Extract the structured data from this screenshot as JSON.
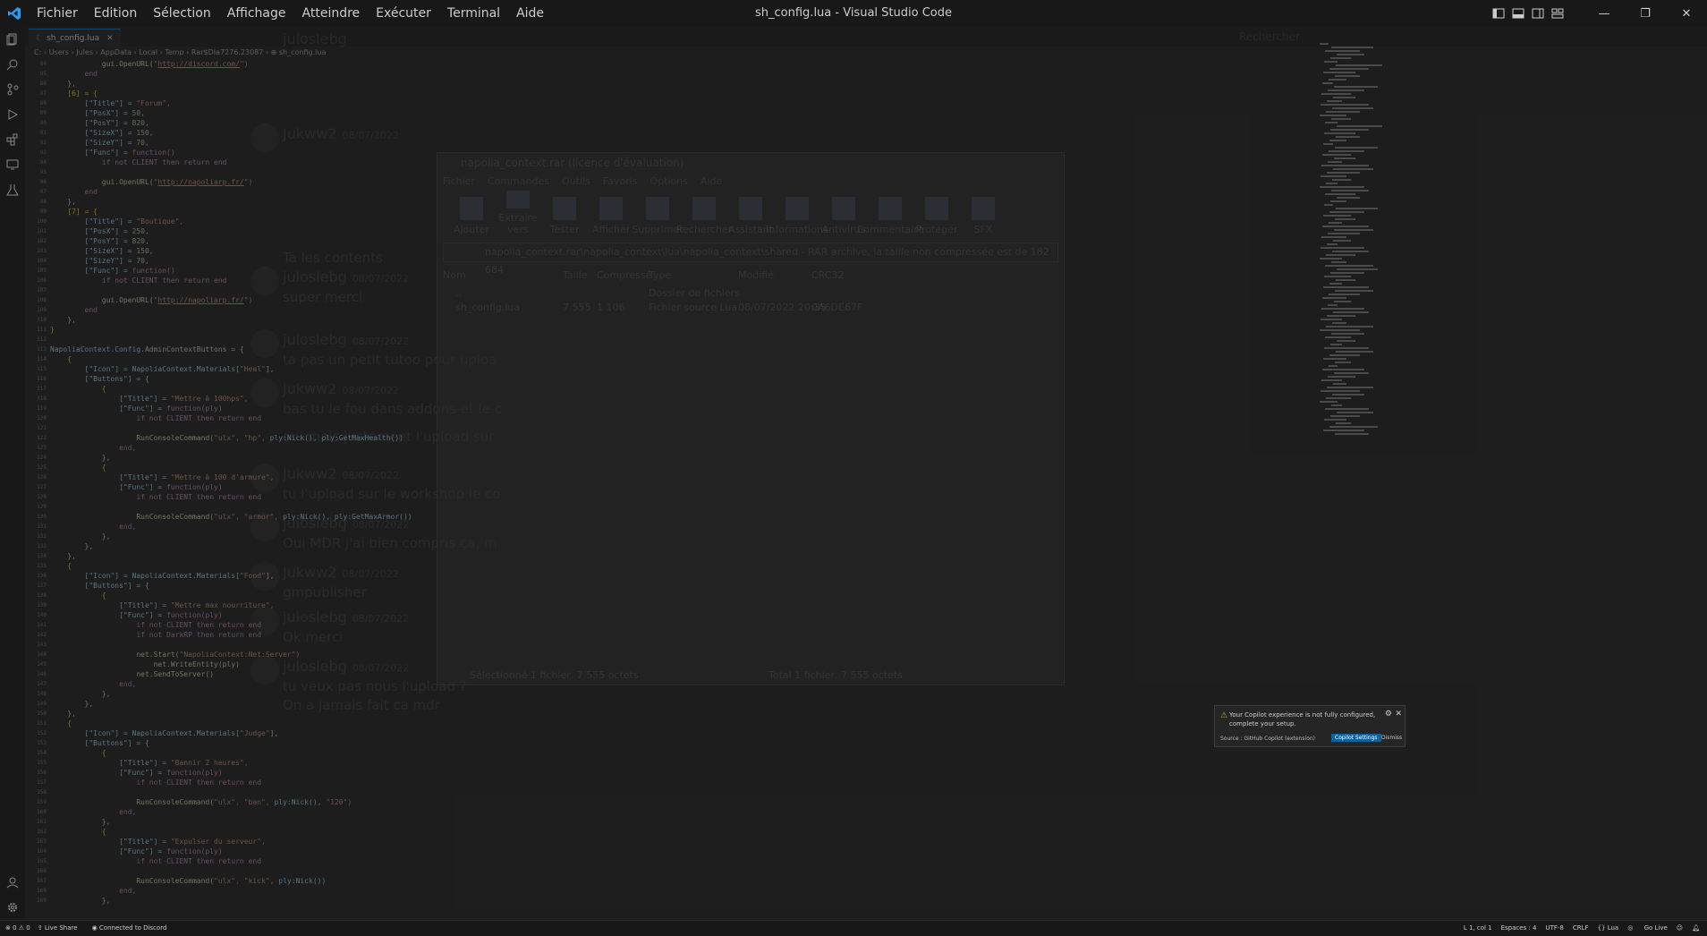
{
  "window": {
    "title": "sh_config.lua - Visual Studio Code"
  },
  "menu": [
    "Fichier",
    "Edition",
    "Sélection",
    "Affichage",
    "Atteindre",
    "Exécuter",
    "Terminal",
    "Aide"
  ],
  "tab": {
    "label": "sh_config.lua",
    "lang_badge": "☾"
  },
  "breadcrumb": "C: › Users › Jules › AppData › Local › Temp › Rar$DIa7276.23087 › ⊕ sh_config.lua",
  "activity_icons": [
    "explorer-icon",
    "search-icon",
    "source-control-icon",
    "run-debug-icon",
    "extensions-icon",
    "remote-explorer-icon",
    "testing-icon"
  ],
  "line_start": 84,
  "code_lines": [
    [
      [
        "            ",
        ""
      ],
      [
        "gui.OpenURL(",
        "f"
      ],
      [
        "\"",
        "s"
      ],
      [
        "http://discord.com/",
        "su"
      ],
      [
        "\")",
        "s"
      ]
    ],
    [
      [
        "        end",
        "k"
      ]
    ],
    [
      [
        "    },",
        ""
      ]
    ],
    [
      [
        "    [6] = {",
        "b"
      ]
    ],
    [
      [
        "        [\"Title\"] = ",
        "v"
      ],
      [
        "\"Forum\",",
        "s"
      ]
    ],
    [
      [
        "        [\"PosX\"] = ",
        "v"
      ],
      [
        "50,",
        "n"
      ]
    ],
    [
      [
        "        [\"PosY\"] = ",
        "v"
      ],
      [
        "820,",
        "n"
      ]
    ],
    [
      [
        "        [\"SizeX\"] = ",
        "v"
      ],
      [
        "150,",
        "n"
      ]
    ],
    [
      [
        "        [\"SizeY\"] = ",
        "v"
      ],
      [
        "70,",
        "n"
      ]
    ],
    [
      [
        "        [\"Func\"] = ",
        "v"
      ],
      [
        "function()",
        "k"
      ]
    ],
    [
      [
        "            if not CLIENT then return end",
        "k"
      ]
    ],
    [
      [
        "",
        ""
      ]
    ],
    [
      [
        "            ",
        ""
      ],
      [
        "gui.OpenURL(",
        "f"
      ],
      [
        "\"",
        "s"
      ],
      [
        "http://napoliarp.fr/",
        "su"
      ],
      [
        "\")",
        "s"
      ]
    ],
    [
      [
        "        end",
        "k"
      ]
    ],
    [
      [
        "    },",
        ""
      ]
    ],
    [
      [
        "    [7] = {",
        "b"
      ]
    ],
    [
      [
        "        [\"Title\"] = ",
        "v"
      ],
      [
        "\"Boutique\",",
        "s"
      ]
    ],
    [
      [
        "        [\"PosX\"] = ",
        "v"
      ],
      [
        "250,",
        "n"
      ]
    ],
    [
      [
        "        [\"PosY\"] = ",
        "v"
      ],
      [
        "820,",
        "n"
      ]
    ],
    [
      [
        "        [\"SizeX\"] = ",
        "v"
      ],
      [
        "150,",
        "n"
      ]
    ],
    [
      [
        "        [\"SizeY\"] = ",
        "v"
      ],
      [
        "70,",
        "n"
      ]
    ],
    [
      [
        "        [\"Func\"] = ",
        "v"
      ],
      [
        "function()",
        "k"
      ]
    ],
    [
      [
        "            if not CLIENT then return end",
        "k"
      ]
    ],
    [
      [
        "",
        ""
      ]
    ],
    [
      [
        "            ",
        ""
      ],
      [
        "gui.OpenURL(",
        "f"
      ],
      [
        "\"",
        "s"
      ],
      [
        "http://napoliarp.fr/",
        "su"
      ],
      [
        "\")",
        "s"
      ]
    ],
    [
      [
        "        end",
        "k"
      ]
    ],
    [
      [
        "    },",
        ""
      ]
    ],
    [
      [
        "}",
        "b"
      ]
    ],
    [
      [
        "",
        ""
      ]
    ],
    [
      [
        "NapoliaContext.",
        "v"
      ],
      [
        "Config",
        "v"
      ],
      [
        ".AdminContextButtons = {",
        ""
      ]
    ],
    [
      [
        "    {",
        "b"
      ]
    ],
    [
      [
        "        [\"Icon\"] = NapoliaContext.Materials[",
        "v"
      ],
      [
        "\"Heal\"",
        "s"
      ],
      [
        "],",
        ""
      ]
    ],
    [
      [
        "        [\"Buttons\"] = {",
        "v"
      ]
    ],
    [
      [
        "            {",
        "b"
      ]
    ],
    [
      [
        "                [\"Title\"] = ",
        "v"
      ],
      [
        "\"Mettre à 100hps\",",
        "s"
      ]
    ],
    [
      [
        "                [\"Func\"] = ",
        "v"
      ],
      [
        "function(ply)",
        "k"
      ]
    ],
    [
      [
        "                    if not CLIENT then return end",
        "k"
      ]
    ],
    [
      [
        "",
        ""
      ]
    ],
    [
      [
        "                    ",
        ""
      ],
      [
        "RunConsoleCommand(",
        "f"
      ],
      [
        "\"ulx\", \"hp\", ",
        "s"
      ],
      [
        "ply:Nick(), ply:GetMaxHealth())",
        "v"
      ]
    ],
    [
      [
        "                end,",
        "k"
      ]
    ],
    [
      [
        "            },",
        ""
      ]
    ],
    [
      [
        "            {",
        "b"
      ]
    ],
    [
      [
        "                [\"Title\"] = ",
        "v"
      ],
      [
        "\"Mettre à 100 d'armure\",",
        "s"
      ]
    ],
    [
      [
        "                [\"Func\"] = ",
        "v"
      ],
      [
        "function(ply)",
        "k"
      ]
    ],
    [
      [
        "                    if not CLIENT then return end",
        "k"
      ]
    ],
    [
      [
        "",
        ""
      ]
    ],
    [
      [
        "                    ",
        ""
      ],
      [
        "RunConsoleCommand(",
        "f"
      ],
      [
        "\"ulx\", \"armor\", ",
        "s"
      ],
      [
        "ply:Nick(), ply:GetMaxArmor())",
        "v"
      ]
    ],
    [
      [
        "                end,",
        "k"
      ]
    ],
    [
      [
        "            },",
        ""
      ]
    ],
    [
      [
        "        },",
        ""
      ]
    ],
    [
      [
        "    },",
        ""
      ]
    ],
    [
      [
        "    {",
        "b"
      ]
    ],
    [
      [
        "        [\"Icon\"] = NapoliaContext.Materials[",
        "v"
      ],
      [
        "\"Food\"",
        "s"
      ],
      [
        "],",
        ""
      ]
    ],
    [
      [
        "        [\"Buttons\"] = {",
        "v"
      ]
    ],
    [
      [
        "            {",
        "b"
      ]
    ],
    [
      [
        "                [\"Title\"] = ",
        "v"
      ],
      [
        "\"Mettre max nourriture\",",
        "s"
      ]
    ],
    [
      [
        "                [\"Func\"] = ",
        "v"
      ],
      [
        "function(ply)",
        "k"
      ]
    ],
    [
      [
        "                    if not CLIENT then return end",
        "k"
      ]
    ],
    [
      [
        "                    if not DarkRP then return end",
        "k"
      ]
    ],
    [
      [
        "",
        ""
      ]
    ],
    [
      [
        "                    ",
        ""
      ],
      [
        "net.Start(",
        "f"
      ],
      [
        "\"NapoliaContext:Net:Server\")",
        "s"
      ]
    ],
    [
      [
        "                        ",
        ""
      ],
      [
        "net.WriteEntity(ply)",
        "f"
      ]
    ],
    [
      [
        "                    ",
        ""
      ],
      [
        "net.SendToServer()",
        "f"
      ]
    ],
    [
      [
        "                end,",
        "k"
      ]
    ],
    [
      [
        "            },",
        ""
      ]
    ],
    [
      [
        "        },",
        ""
      ]
    ],
    [
      [
        "    },",
        ""
      ]
    ],
    [
      [
        "    {",
        "b"
      ]
    ],
    [
      [
        "        [\"Icon\"] = NapoliaContext.Materials[",
        "v"
      ],
      [
        "\"Judge\"",
        "s"
      ],
      [
        "],",
        ""
      ]
    ],
    [
      [
        "        [\"Buttons\"] = {",
        "v"
      ]
    ],
    [
      [
        "            {",
        "b"
      ]
    ],
    [
      [
        "                [\"Title\"] = ",
        "v"
      ],
      [
        "\"Bannir 2 heures\",",
        "s"
      ]
    ],
    [
      [
        "                [\"Func\"] = ",
        "v"
      ],
      [
        "function(ply)",
        "k"
      ]
    ],
    [
      [
        "                    if not CLIENT then return end",
        "k"
      ]
    ],
    [
      [
        "",
        ""
      ]
    ],
    [
      [
        "                    ",
        ""
      ],
      [
        "RunConsoleCommand(",
        "f"
      ],
      [
        "\"ulx\", \"ban\", ",
        "s"
      ],
      [
        "ply:Nick(), ",
        "v"
      ],
      [
        "\"120\")",
        "s"
      ]
    ],
    [
      [
        "                end,",
        "k"
      ]
    ],
    [
      [
        "            },",
        ""
      ]
    ],
    [
      [
        "            {",
        "b"
      ]
    ],
    [
      [
        "                [\"Title\"] = ",
        "v"
      ],
      [
        "\"Expulser du serveur\",",
        "s"
      ]
    ],
    [
      [
        "                [\"Func\"] = ",
        "v"
      ],
      [
        "function(ply)",
        "k"
      ]
    ],
    [
      [
        "                    if not CLIENT then return end",
        "k"
      ]
    ],
    [
      [
        "",
        ""
      ]
    ],
    [
      [
        "                    ",
        ""
      ],
      [
        "RunConsoleCommand(",
        "f"
      ],
      [
        "\"ulx\", \"kick\", ",
        "s"
      ],
      [
        "ply:Nick())",
        "v"
      ]
    ],
    [
      [
        "                end,",
        "k"
      ]
    ],
    [
      [
        "            },",
        ""
      ]
    ]
  ],
  "background_discord": {
    "channel": "juloslebg",
    "search": "Rechercher",
    "messages": [
      {
        "author": "Jukww2",
        "time": "08/07/2022",
        "text": ""
      },
      {
        "author": "",
        "time": "",
        "text": "Ta les contents"
      },
      {
        "author": "juloslebg",
        "time": "08/07/2022",
        "text": "super merci"
      },
      {
        "author": "juloslebg",
        "time": "08/07/2022",
        "text": "ta pas un petit tutoo pour uploa"
      },
      {
        "author": "Jukww2",
        "time": "08/07/2022",
        "text": "bas tu le fou dans addons et le c"
      },
      {
        "author": "",
        "time": "",
        "text": "oui mais justement l'upload sur"
      },
      {
        "author": "Jukww2",
        "time": "08/07/2022",
        "text": "tu l'upload sur le workshop le co"
      },
      {
        "author": "juloslebg",
        "time": "08/07/2022",
        "text": "Oui MDR j'ai bien compris ça, m"
      },
      {
        "author": "Jukww2",
        "time": "08/07/2022",
        "text": "gmpublisher"
      },
      {
        "author": "juloslebg",
        "time": "08/07/2022",
        "text": "Ok merci"
      },
      {
        "author": "juloslebg",
        "time": "08/07/2022",
        "text": "tu veux pas nous l'upload ?"
      },
      {
        "author": "",
        "time": "",
        "text": "On a jamais fait ca mdr"
      }
    ]
  },
  "winrar": {
    "title": "napolia_context.rar (licence d'évaluation)",
    "menu": [
      "Fichier",
      "Commandes",
      "Outils",
      "Favoris",
      "Options",
      "Aide"
    ],
    "tools": [
      "Ajouter",
      "Extraire vers",
      "Tester",
      "Afficher",
      "Supprimer",
      "Rechercher",
      "Assistant",
      "Informations",
      "Antivirus",
      "Commentaire",
      "Protéger",
      "SFX"
    ],
    "path": "napolia_context.rar\\napolia_context\\lua\\napolia_context\\shared - RAR archive, la taille non compressée est de 182 684",
    "columns": [
      "Nom",
      "Taille",
      "Compressé",
      "Type",
      "Modifié",
      "CRC32"
    ],
    "rows": [
      [
        "..",
        "",
        "",
        "Dossier de fichiers",
        "",
        ""
      ],
      [
        "sh_config.lua",
        "7 555",
        "1 106",
        "Fichier source Lua",
        "08/07/2022 20:35",
        "0A6DE67F"
      ]
    ],
    "status_left": "Sélectionné 1 fichier, 7 555 octets",
    "status_right": "Total 1 fichier, 7 555 octets"
  },
  "copilot_toast": {
    "message": "Your Copilot experience is not fully configured, complete your setup.",
    "source": "Source : GitHub Copilot (extension)",
    "primary_button": "Copilot Settings",
    "secondary_button": "Dismiss"
  },
  "statusbar": {
    "problems": "⊗ 0 ⚠ 0",
    "live_share": "Live Share",
    "discord": "Connected to Discord",
    "position": "L 1, col 1",
    "spaces": "Espaces : 4",
    "encoding": "UTF-8",
    "eol": "CRLF",
    "language": "{} Lua",
    "golive": "Go Live"
  },
  "colors": {
    "accent": "#0078d4",
    "editor_bg": "#1e1e1e",
    "chrome_bg": "#181818",
    "vscode_logo": "#2f9bf0"
  }
}
